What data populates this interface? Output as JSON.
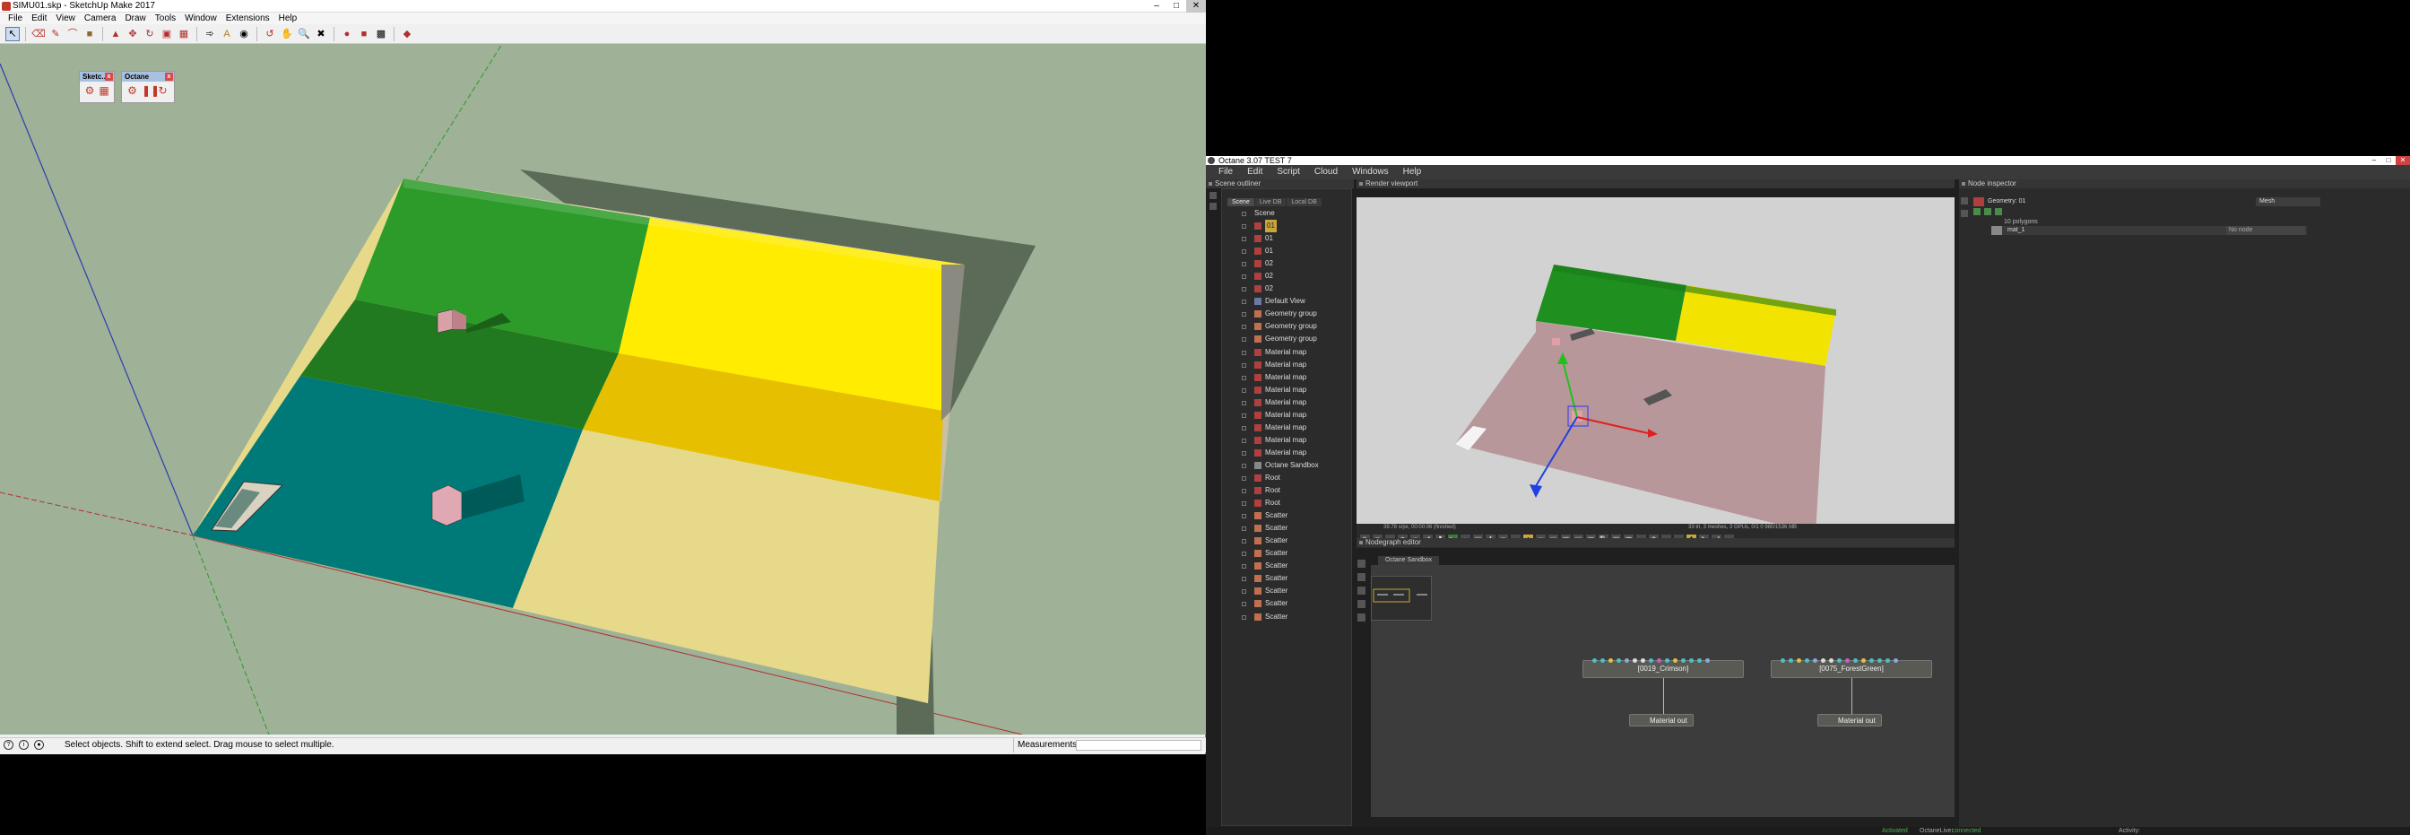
{
  "sketchup": {
    "title": "SIMU01.skp - SketchUp Make 2017",
    "menu": [
      "File",
      "Edit",
      "View",
      "Camera",
      "Draw",
      "Tools",
      "Window",
      "Extensions",
      "Help"
    ],
    "palettes": [
      {
        "title": "Sketc..."
      },
      {
        "title": "Octane"
      }
    ],
    "status_text": "Select objects. Shift to extend select. Drag mouse to select multiple.",
    "measurements_label": "Measurements",
    "colors": {
      "background": "#9fb197",
      "green": "#2d9b2a",
      "green_dark": "#217a1f",
      "yellow": "#ffec00",
      "yellow_dark": "#e6c000",
      "teal": "#007a78",
      "cream": "#e6d98a",
      "shadow": "#5c6b58"
    }
  },
  "octane": {
    "title": "Octane 3.07 TEST 7",
    "menu": [
      "File",
      "Edit",
      "Script",
      "Cloud",
      "Windows",
      "Help"
    ],
    "scene_outliner": {
      "title": "Scene outliner",
      "tabs": [
        "Scene",
        "Live DB",
        "Local DB"
      ],
      "items": [
        "Scene",
        "01",
        "01",
        "01",
        "02",
        "02",
        "02",
        "Default View",
        "Geometry group",
        "Geometry group",
        "Geometry group",
        "Material map",
        "Material map",
        "Material map",
        "Material map",
        "Material map",
        "Material map",
        "Material map",
        "Material map",
        "Material map",
        "Octane Sandbox",
        "Root",
        "Root",
        "Root",
        "Scatter",
        "Scatter",
        "Scatter",
        "Scatter",
        "Scatter",
        "Scatter",
        "Scatter",
        "Scatter",
        "Scatter"
      ]
    },
    "render_viewport": {
      "title": "Render viewport",
      "info_left": "39.78 s/px, 00:00:06 (finished)",
      "info_right": "33 tri, 3 meshes, 3 GPUs, 0/1 0 980/1536 MB"
    },
    "node_inspector": {
      "title": "Node inspector",
      "geometry": "Geometry: 01",
      "mesh_type": "Mesh",
      "polygons": "10 polygons",
      "material_name": "mat_1",
      "material_value": "No node"
    },
    "nodegraph": {
      "title": "Nodegraph editor",
      "tab": "Octane Sandbox",
      "nodes": [
        {
          "label": "[0019_Crimson]",
          "output": "Material out"
        },
        {
          "label": "[0075_ForestGreen]",
          "output": "Material out"
        }
      ]
    },
    "status": {
      "activated": "Activated",
      "live_label": "OctaneLive:",
      "live_value": "connected",
      "activity": "Activity:"
    }
  }
}
